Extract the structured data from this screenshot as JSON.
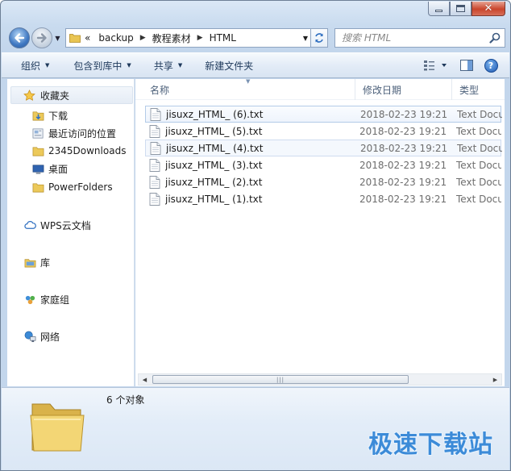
{
  "window": {
    "caption_buttons": [
      "minimize",
      "maximize",
      "close"
    ]
  },
  "navigation": {
    "back_icon": "back-arrow-icon",
    "forward_icon": "forward-arrow-icon"
  },
  "address_bar": {
    "prefix": "«",
    "crumbs": [
      "backup",
      "教程素材",
      "HTML"
    ],
    "dropdown_icon": "chevron-down-icon",
    "refresh_icon": "refresh-icon"
  },
  "search": {
    "placeholder": "搜索 HTML"
  },
  "toolbar": {
    "organize": "组织",
    "include_in_library": "包含到库中",
    "share": "共享",
    "new_folder": "新建文件夹",
    "view_icon": "view-options-icon",
    "preview_icon": "preview-pane-icon",
    "help_icon": "help-icon"
  },
  "nav_pane": {
    "favorites": "收藏夹",
    "favorites_items": [
      "下载",
      "最近访问的位置",
      "2345Downloads",
      "桌面",
      "PowerFolders"
    ],
    "wps": "WPS云文档",
    "libraries": "库",
    "homegroup": "家庭组",
    "network": "网络"
  },
  "columns": {
    "name": "名称",
    "date_modified": "修改日期",
    "type": "类型"
  },
  "files": [
    {
      "name": "jisuxz_HTML_ (6).txt",
      "date": "2018-02-23 19:21",
      "type": "Text Document",
      "state": "selected"
    },
    {
      "name": "jisuxz_HTML_ (5).txt",
      "date": "2018-02-23 19:21",
      "type": "Text Document",
      "state": ""
    },
    {
      "name": "jisuxz_HTML_ (4).txt",
      "date": "2018-02-23 19:21",
      "type": "Text Document",
      "state": "hover"
    },
    {
      "name": "jisuxz_HTML_ (3).txt",
      "date": "2018-02-23 19:21",
      "type": "Text Document",
      "state": ""
    },
    {
      "name": "jisuxz_HTML_ (2).txt",
      "date": "2018-02-23 19:21",
      "type": "Text Document",
      "state": ""
    },
    {
      "name": "jisuxz_HTML_ (1).txt",
      "date": "2018-02-23 19:21",
      "type": "Text Document",
      "state": ""
    }
  ],
  "status": {
    "count": "6 个对象"
  },
  "watermark": "极速下载站",
  "colors": {
    "accent": "#3c8bd8",
    "selection_border": "#b3cbe8",
    "window_frame": "#c9dbef"
  }
}
